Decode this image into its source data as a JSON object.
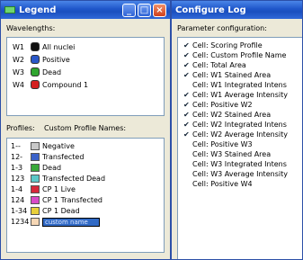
{
  "legend_window": {
    "title": "Legend",
    "wavelengths_label": "Wavelengths:",
    "wavelengths": [
      {
        "id": "W1",
        "name": "All nuclei",
        "color": "#111111"
      },
      {
        "id": "W2",
        "name": "Positive",
        "color": "#2a57c8"
      },
      {
        "id": "W3",
        "name": "Dead",
        "color": "#2fa52f"
      },
      {
        "id": "W4",
        "name": "Compound 1",
        "color": "#d42020"
      }
    ],
    "profiles_label": "Profiles:",
    "custom_names_label": "Custom Profile Names:",
    "profiles": [
      {
        "id": "1--",
        "name": "Negative",
        "color": "#c8c8c8"
      },
      {
        "id": "12-",
        "name": "Transfected",
        "color": "#3a62c9"
      },
      {
        "id": "1-3",
        "name": "Dead",
        "color": "#39a83a"
      },
      {
        "id": "123",
        "name": "Transfected Dead",
        "color": "#5cc7c7"
      },
      {
        "id": "1-4",
        "name": "CP 1 Live",
        "color": "#d6283b"
      },
      {
        "id": "124",
        "name": "CP 1 Transfected",
        "color": "#d84ac8"
      },
      {
        "id": "1-34",
        "name": "CP 1 Dead",
        "color": "#e8cf3a"
      },
      {
        "id": "1234",
        "name": "custom name",
        "color": "#f6d7b5"
      }
    ]
  },
  "config_window": {
    "title": "Configure Log",
    "param_label": "Parameter configuration:",
    "params": [
      {
        "checked": true,
        "name": "Cell: Scoring Profile"
      },
      {
        "checked": true,
        "name": "Cell: Custom Profile Name"
      },
      {
        "checked": true,
        "name": "Cell: Total Area"
      },
      {
        "checked": true,
        "name": "Cell: W1 Stained Area"
      },
      {
        "checked": false,
        "name": "Cell: W1 Integrated Intens"
      },
      {
        "checked": true,
        "name": "Cell: W1 Average Intensity"
      },
      {
        "checked": true,
        "name": "Cell: Positive W2"
      },
      {
        "checked": true,
        "name": "Cell: W2 Stained Area"
      },
      {
        "checked": true,
        "name": "Cell: W2 Integrated Intens"
      },
      {
        "checked": true,
        "name": "Cell: W2 Average Intensity"
      },
      {
        "checked": false,
        "name": "Cell: Positive W3"
      },
      {
        "checked": false,
        "name": "Cell: W3 Stained Area"
      },
      {
        "checked": false,
        "name": "Cell: W3 Integrated Intens"
      },
      {
        "checked": false,
        "name": "Cell: W3 Average Intensity"
      },
      {
        "checked": false,
        "name": "Cell: Positive W4"
      }
    ]
  },
  "checkmark": "✔"
}
